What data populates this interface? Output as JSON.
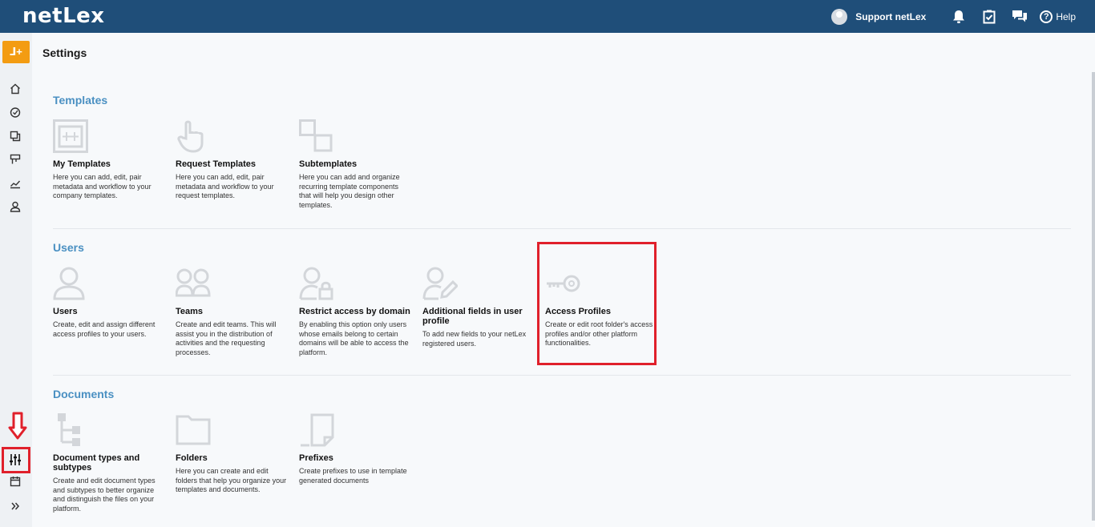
{
  "app": {
    "logo": "netLex"
  },
  "topbar": {
    "user_name": "Support netLex",
    "help_label": "Help",
    "icons": [
      "user-avatar-icon",
      "bell-icon",
      "clipboard-check-icon",
      "chat-icon",
      "help-icon"
    ]
  },
  "sidebar": {
    "brand_glyph": "ᒧ+",
    "items": [
      "home-icon",
      "dashboard-icon",
      "documents-icon",
      "kanban-icon",
      "analytics-icon",
      "user-icon",
      "settings-sliders-icon",
      "calendar-icon",
      "expand-icon"
    ]
  },
  "page": {
    "title": "Settings"
  },
  "sections": {
    "templates": {
      "title": "Templates",
      "cards": [
        {
          "title": "My Templates",
          "desc": "Here you can add, edit, pair metadata and workflow to your company templates."
        },
        {
          "title": "Request Templates",
          "desc": "Here you can add, edit, pair metadata and workflow to your request templates."
        },
        {
          "title": "Subtemplates",
          "desc": "Here you can add and organize recurring template components that will help you design other templates."
        }
      ]
    },
    "users": {
      "title": "Users",
      "cards": [
        {
          "title": "Users",
          "desc": "Create, edit and assign different access profiles to your users."
        },
        {
          "title": "Teams",
          "desc": "Create and edit teams. This will assist you in the distribution of activities and the requesting processes."
        },
        {
          "title": "Restrict access by domain",
          "desc": "By enabling this option only users whose emails belong to certain domains will be able to access the platform."
        },
        {
          "title": "Additional fields in user profile",
          "desc": "To add new fields to your netLex registered users."
        },
        {
          "title": "Access Profiles",
          "desc": "Create or edit root folder's access profiles and/or other platform functionalities."
        }
      ]
    },
    "documents": {
      "title": "Documents",
      "cards": [
        {
          "title": "Document types and subtypes",
          "desc": "Create and edit document types and subtypes to better organize and distinguish the files on your platform."
        },
        {
          "title": "Folders",
          "desc": "Here you can create and edit folders that help you organize your templates and documents."
        },
        {
          "title": "Prefixes",
          "desc": "Create prefixes to use in template generated documents"
        }
      ]
    }
  },
  "colors": {
    "topbar": "#1f4e79",
    "accent": "#4a90c2",
    "brand": "#f39c12",
    "highlight": "#e0202b"
  }
}
